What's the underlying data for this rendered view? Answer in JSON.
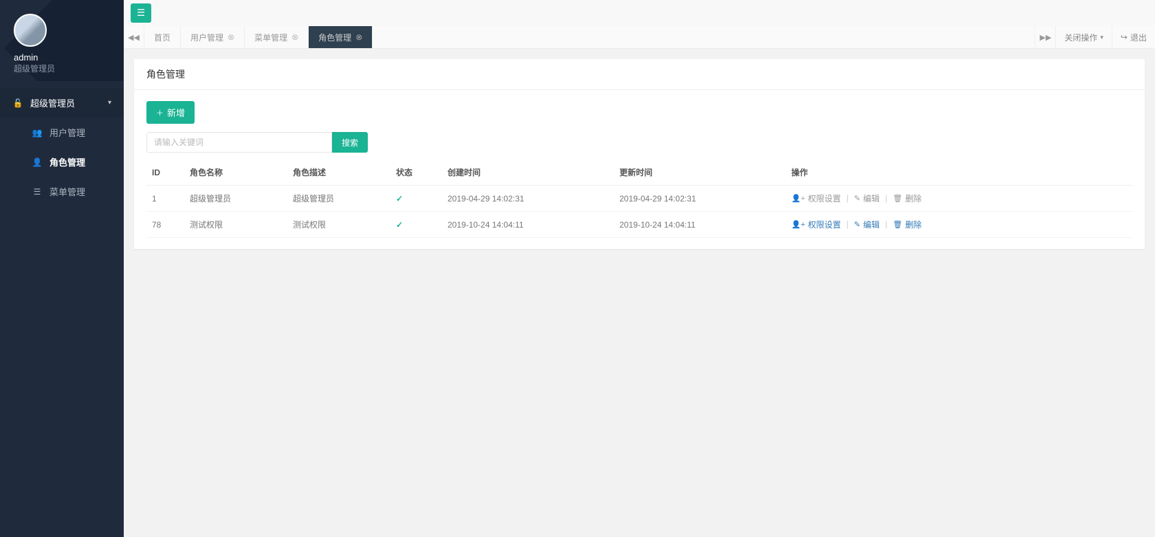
{
  "sidebar": {
    "user_name": "admin",
    "user_role": "超级管理员",
    "top_item": {
      "label": "超级管理员"
    },
    "items": [
      {
        "label": "用户管理",
        "icon": "users-icon"
      },
      {
        "label": "角色管理",
        "icon": "user-icon",
        "active": true
      },
      {
        "label": "菜单管理",
        "icon": "list-icon"
      }
    ]
  },
  "topbar": {
    "tabs": [
      {
        "label": "首页",
        "closable": false
      },
      {
        "label": "用户管理",
        "closable": true
      },
      {
        "label": "菜单管理",
        "closable": true
      },
      {
        "label": "角色管理",
        "closable": true,
        "active": true
      }
    ],
    "close_ops_label": "关闭操作",
    "logout_label": "退出"
  },
  "panel": {
    "title": "角色管理",
    "add_label": "新增",
    "search_placeholder": "请输入关键词",
    "search_label": "搜索",
    "columns": {
      "id": "ID",
      "name": "角色名称",
      "desc": "角色描述",
      "status": "状态",
      "created": "创建时间",
      "updated": "更新时间",
      "ops": "操作"
    },
    "ops": {
      "perm": "权限设置",
      "edit": "编辑",
      "delete": "删除"
    },
    "rows": [
      {
        "id": "1",
        "name": "超级管理员",
        "desc": "超级管理员",
        "status": true,
        "created": "2019-04-29 14:02:31",
        "updated": "2019-04-29 14:02:31",
        "muted": true
      },
      {
        "id": "78",
        "name": "测试权限",
        "desc": "测试权限",
        "status": true,
        "created": "2019-10-24 14:04:11",
        "updated": "2019-10-24 14:04:11",
        "muted": false
      }
    ]
  }
}
